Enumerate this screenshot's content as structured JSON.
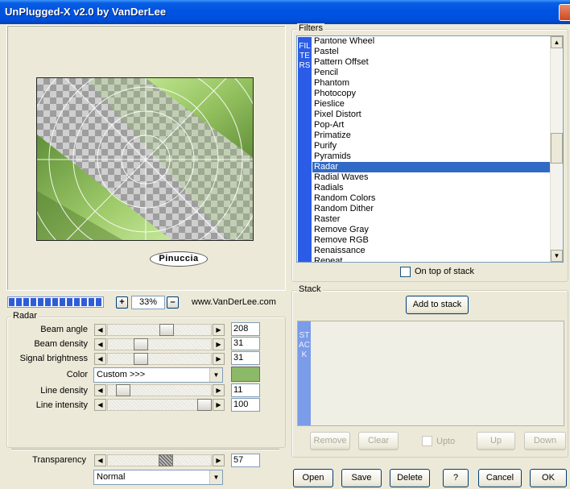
{
  "window": {
    "title": "UnPlugged-X v2.0 by VanDerLee"
  },
  "preview": {
    "logo_text": "Pinuccia"
  },
  "zoom": {
    "plus_label": "+",
    "minus_label": "–",
    "value": "33%",
    "progress": 1.0
  },
  "website": "www.VanDerLee.com",
  "params": {
    "group_label": "Radar",
    "rows": [
      {
        "label": "Beam angle",
        "value": "208"
      },
      {
        "label": "Beam density",
        "value": "31"
      },
      {
        "label": "Signal brightness",
        "value": "31"
      },
      {
        "label": "Color",
        "value": "Custom >>>",
        "swatch": "#8bb968"
      },
      {
        "label": "Line density",
        "value": "11"
      },
      {
        "label": "Line intensity",
        "value": "100"
      }
    ],
    "transparency_label": "Transparency",
    "transparency_value": "57",
    "blend_mode": "Normal"
  },
  "filters": {
    "group_label": "Filters",
    "stripe_text": "FILTERS",
    "items": [
      "Pantone Wheel",
      "Pastel",
      "Pattern Offset",
      "Pencil",
      "Phantom",
      "Photocopy",
      "Pieslice",
      "Pixel Distort",
      "Pop-Art",
      "Primatize",
      "Purify",
      "Pyramids",
      "Radar",
      "Radial Waves",
      "Radials",
      "Random Colors",
      "Random Dither",
      "Raster",
      "Remove Gray",
      "Remove RGB",
      "Renaissance",
      "Repeat"
    ],
    "selected": "Radar",
    "on_top_label": "On top of stack"
  },
  "stack": {
    "group_label": "Stack",
    "add_label": "Add to stack",
    "stripe_text": "STACK",
    "remove_label": "Remove",
    "clear_label": "Clear",
    "upto_label": "Upto",
    "up_label": "Up",
    "down_label": "Down"
  },
  "buttons": {
    "open": "Open",
    "save": "Save",
    "delete": "Delete",
    "help": "?",
    "cancel": "Cancel",
    "ok": "OK"
  },
  "colors": {
    "selection": "#316ac5",
    "stripe": "#2b5ce7",
    "swatch": "#8bb968"
  }
}
